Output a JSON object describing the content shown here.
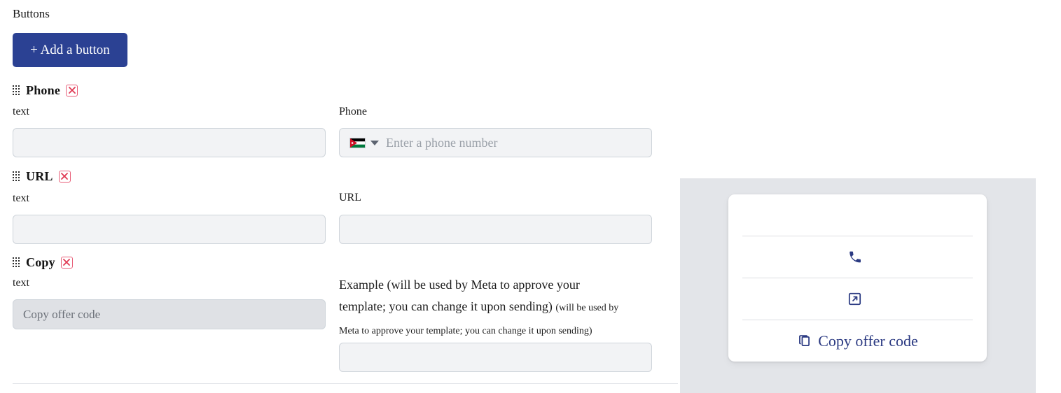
{
  "section": {
    "title": "Buttons",
    "add_button_label": "+ Add a button"
  },
  "colors": {
    "primary": "#2b4193",
    "preview_accent": "#2b3a82",
    "delete_border": "#e8607a",
    "delete_x": "#e03b55",
    "panel_bg": "#e3e5e9",
    "input_bg": "#f2f3f5",
    "input_disabled_bg": "#dfe1e5",
    "input_border": "#ced4da"
  },
  "buttons": [
    {
      "name": "Phone",
      "drag_icon": "drag-dots-icon",
      "delete_icon": "close-x-icon",
      "text_label": "text",
      "text_value": "",
      "text_placeholder": "",
      "value_label": "Phone",
      "phone_placeholder": "Enter a phone number",
      "country_flag": "jordan-flag-icon",
      "country_caret": "chevron-down-icon"
    },
    {
      "name": "URL",
      "drag_icon": "drag-dots-icon",
      "delete_icon": "close-x-icon",
      "text_label": "text",
      "text_value": "",
      "text_placeholder": "",
      "value_label": "URL",
      "value": "",
      "value_placeholder": ""
    },
    {
      "name": "Copy",
      "drag_icon": "drag-dots-icon",
      "delete_icon": "close-x-icon",
      "text_label": "text",
      "text_value": "Copy offer code",
      "text_disabled": true,
      "value_label_main": "Example (will be used by Meta to approve your template; you can change it upon sending)",
      "value_label_hint": "(will be used by Meta to approve your template; you can change it upon sending)",
      "value": "",
      "value_placeholder": ""
    }
  ],
  "preview": {
    "rows": [
      {
        "icon": "phone-icon",
        "label": ""
      },
      {
        "icon": "external-link-icon",
        "label": ""
      },
      {
        "icon": "copy-icon",
        "label": "Copy offer code"
      }
    ]
  }
}
